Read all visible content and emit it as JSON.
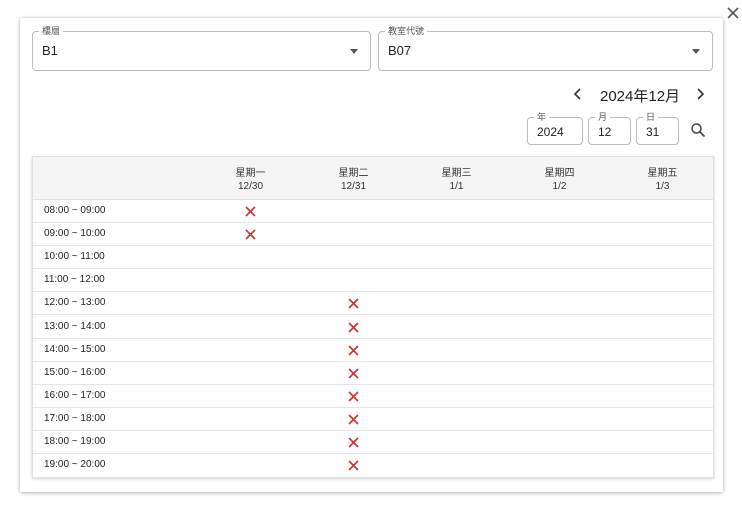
{
  "filters": {
    "floor": {
      "label": "樓層",
      "value": "B1"
    },
    "room": {
      "label": "教室代號",
      "value": "B07"
    }
  },
  "calendar": {
    "month_label": "2024年12月",
    "prev_icon": "chevron-left-icon",
    "next_icon": "chevron-right-icon"
  },
  "search": {
    "year": {
      "label": "年",
      "value": "2024"
    },
    "month": {
      "label": "月",
      "value": "12"
    },
    "day": {
      "label": "日",
      "value": "31"
    },
    "icon": "search-icon"
  },
  "schedule": {
    "days": [
      {
        "weekday": "星期一",
        "date": "12/30"
      },
      {
        "weekday": "星期二",
        "date": "12/31"
      },
      {
        "weekday": "星期三",
        "date": "1/1"
      },
      {
        "weekday": "星期四",
        "date": "1/2"
      },
      {
        "weekday": "星期五",
        "date": "1/3"
      }
    ],
    "slots": [
      {
        "time": "08:00 ~ 09:00",
        "booked": [
          true,
          false,
          false,
          false,
          false
        ]
      },
      {
        "time": "09:00 ~ 10:00",
        "booked": [
          true,
          false,
          false,
          false,
          false
        ]
      },
      {
        "time": "10:00 ~ 11:00",
        "booked": [
          false,
          false,
          false,
          false,
          false
        ]
      },
      {
        "time": "11:00 ~ 12:00",
        "booked": [
          false,
          false,
          false,
          false,
          false
        ]
      },
      {
        "time": "12:00 ~ 13:00",
        "booked": [
          false,
          true,
          false,
          false,
          false
        ]
      },
      {
        "time": "13:00 ~ 14:00",
        "booked": [
          false,
          true,
          false,
          false,
          false
        ]
      },
      {
        "time": "14:00 ~ 15:00",
        "booked": [
          false,
          true,
          false,
          false,
          false
        ]
      },
      {
        "time": "15:00 ~ 16:00",
        "booked": [
          false,
          true,
          false,
          false,
          false
        ]
      },
      {
        "time": "16:00 ~ 17:00",
        "booked": [
          false,
          true,
          false,
          false,
          false
        ]
      },
      {
        "time": "17:00 ~ 18:00",
        "booked": [
          false,
          true,
          false,
          false,
          false
        ]
      },
      {
        "time": "18:00 ~ 19:00",
        "booked": [
          false,
          true,
          false,
          false,
          false
        ]
      },
      {
        "time": "19:00 ~ 20:00",
        "booked": [
          false,
          true,
          false,
          false,
          false
        ]
      }
    ],
    "booked_icon": "close-x-icon",
    "booked_color": "#d32f2f"
  },
  "close_icon": "close-icon"
}
